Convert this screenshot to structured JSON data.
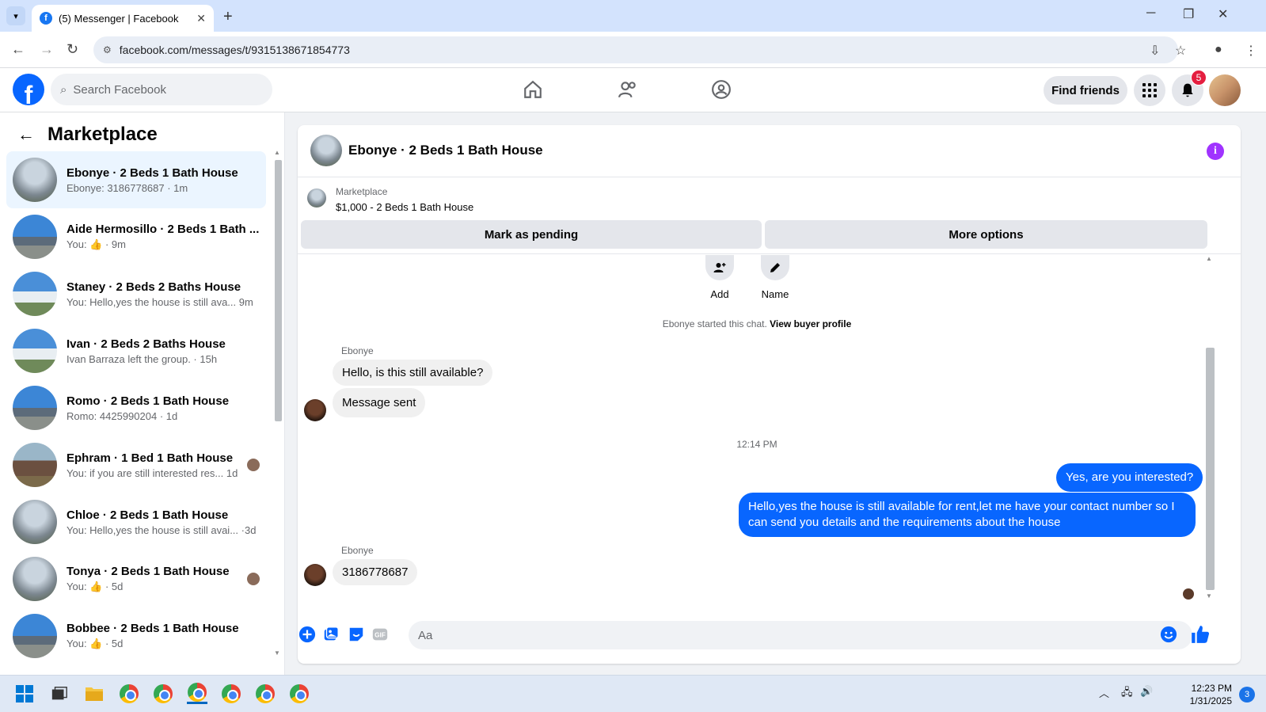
{
  "browser": {
    "tab_title": "(5) Messenger | Facebook",
    "url": "facebook.com/messages/t/9315138671854773"
  },
  "fb_nav": {
    "search_placeholder": "Search Facebook",
    "find_friends": "Find friends",
    "notification_count": "5"
  },
  "sidebar": {
    "title": "Marketplace",
    "conversations": [
      {
        "name": "Ebonye · 2 Beds 1 Bath House",
        "preview": "Ebonye: 3186778687 · 1m",
        "thumb": "house1",
        "active": true
      },
      {
        "name": "Aide Hermosillo · 2 Beds 1 Bath ...",
        "preview": "You: 👍 · 9m",
        "thumb": "house2",
        "active": false
      },
      {
        "name": "Staney · 2 Beds 2 Baths House",
        "preview": "You: Hello,yes the house is still ava... 9m",
        "thumb": "house3",
        "active": false
      },
      {
        "name": "Ivan · 2 Beds 2 Baths House",
        "preview": "Ivan Barraza left the group. · 15h",
        "thumb": "house3",
        "active": false
      },
      {
        "name": "Romo · 2 Beds 1 Bath House",
        "preview": "Romo: 4425990204 · 1d",
        "thumb": "house2",
        "active": false
      },
      {
        "name": "Ephram · 1 Bed 1 Bath House",
        "preview": "You: if you are still interested res... 1d",
        "thumb": "house4",
        "active": false,
        "seen": true
      },
      {
        "name": "Chloe · 2 Beds 1 Bath House",
        "preview": "You: Hello,yes the house is still avai... ·3d",
        "thumb": "house1",
        "active": false
      },
      {
        "name": "Tonya · 2 Beds 1 Bath House",
        "preview": "You: 👍 · 5d",
        "thumb": "house1",
        "active": false,
        "seen": true
      },
      {
        "name": "Bobbee · 2 Beds 1 Bath House",
        "preview": "You: 👍 · 5d",
        "thumb": "house2",
        "active": false
      }
    ]
  },
  "chat": {
    "title": "Ebonye · 2 Beds 1 Bath House",
    "marketplace_label": "Marketplace",
    "listing": "$1,000 - 2 Beds 1 Bath House",
    "mark_pending": "Mark as pending",
    "more_options": "More options",
    "add_label": "Add",
    "name_label": "Name",
    "started_text": "Ebonye started this chat.",
    "view_profile": "View buyer profile",
    "sender1": "Ebonye",
    "msg1": "Hello, is this still available?",
    "msg2": "Message sent",
    "timestamp": "12:14 PM",
    "out1": "Yes, are you interested?",
    "out2": "Hello,yes the house is still available for rent,let me have your contact number   so I can send you details and the requirements about the house",
    "sender2": "Ebonye",
    "msg3": "3186778687",
    "composer_placeholder": "Aa"
  },
  "taskbar": {
    "time": "12:23 PM",
    "date": "1/31/2025",
    "badge": "3"
  },
  "colors": {
    "fb_blue": "#0866ff",
    "notif_red": "#e41e3f",
    "info_purple": "#a033ff"
  }
}
